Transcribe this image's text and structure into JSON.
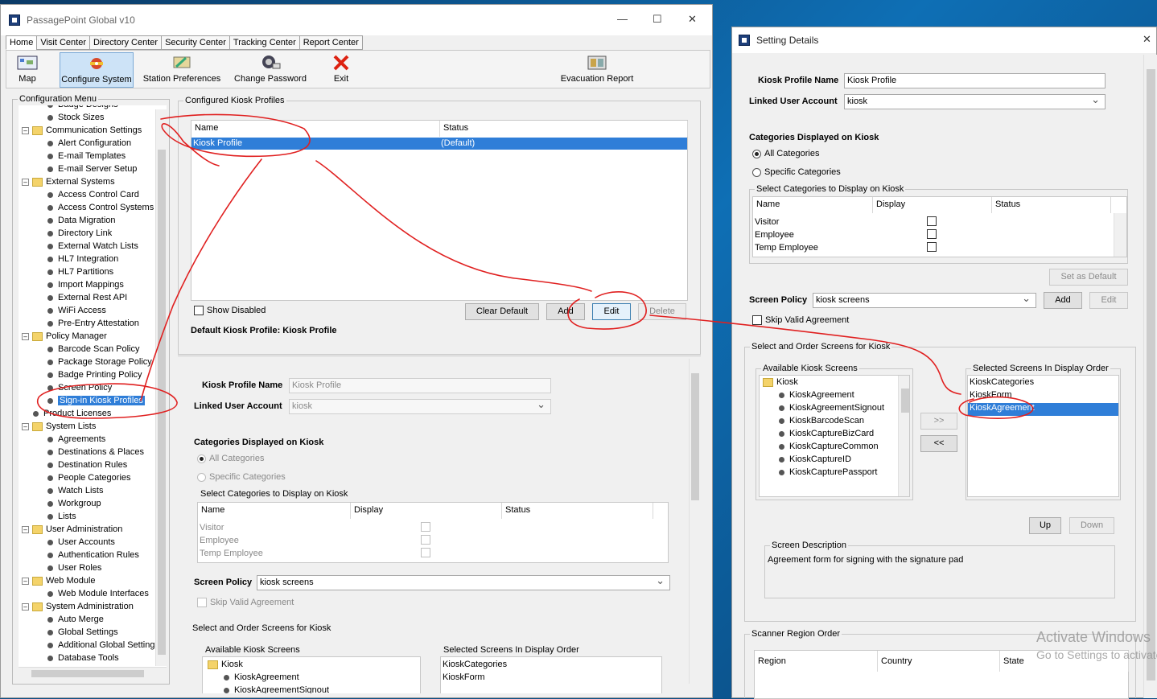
{
  "main_window": {
    "title": "PassagePoint Global v10",
    "tabs": [
      "Home",
      "Visit Center",
      "Directory Center",
      "Security Center",
      "Tracking Center",
      "Report Center"
    ],
    "toolbar": {
      "map": "Map",
      "configure": "Configure System",
      "station": "Station Preferences",
      "password": "Change Password",
      "exit": "Exit",
      "evac": "Evacuation Report"
    },
    "menu_title": "Configuration Menu",
    "tree": [
      {
        "t": "Badge Designs",
        "lvl": 2
      },
      {
        "t": "Stock Sizes",
        "lvl": 2
      },
      {
        "t": "Communication Settings",
        "lvl": 1
      },
      {
        "t": "Alert Configuration",
        "lvl": 2
      },
      {
        "t": "E-mail Templates",
        "lvl": 2
      },
      {
        "t": "E-mail Server Setup",
        "lvl": 2
      },
      {
        "t": "External Systems",
        "lvl": 1
      },
      {
        "t": "Access Control Card",
        "lvl": 2
      },
      {
        "t": "Access Control Systems",
        "lvl": 2
      },
      {
        "t": "Data Migration",
        "lvl": 2
      },
      {
        "t": "Directory Link",
        "lvl": 2
      },
      {
        "t": "External Watch Lists",
        "lvl": 2
      },
      {
        "t": "HL7 Integration",
        "lvl": 2
      },
      {
        "t": "HL7 Partitions",
        "lvl": 2
      },
      {
        "t": "Import Mappings",
        "lvl": 2
      },
      {
        "t": "External Rest API",
        "lvl": 2
      },
      {
        "t": "WiFi Access",
        "lvl": 2
      },
      {
        "t": "Pre-Entry Attestation",
        "lvl": 2
      },
      {
        "t": "Policy Manager",
        "lvl": 1
      },
      {
        "t": "Barcode Scan Policy",
        "lvl": 2
      },
      {
        "t": "Package Storage Policy",
        "lvl": 2
      },
      {
        "t": "Badge Printing Policy",
        "lvl": 2
      },
      {
        "t": "Screen Policy",
        "lvl": 2
      },
      {
        "t": "Sign-in Kiosk Profiles",
        "lvl": 2,
        "sel": true
      },
      {
        "t": "Product Licenses",
        "lvl": 0
      },
      {
        "t": "System Lists",
        "lvl": 1
      },
      {
        "t": "Agreements",
        "lvl": 2
      },
      {
        "t": "Destinations & Places",
        "lvl": 2
      },
      {
        "t": "Destination Rules",
        "lvl": 2
      },
      {
        "t": "People Categories",
        "lvl": 2
      },
      {
        "t": "Watch Lists",
        "lvl": 2
      },
      {
        "t": "Workgroup",
        "lvl": 2
      },
      {
        "t": "Lists",
        "lvl": 2
      },
      {
        "t": "User Administration",
        "lvl": 1
      },
      {
        "t": "User Accounts",
        "lvl": 2
      },
      {
        "t": "Authentication Rules",
        "lvl": 2
      },
      {
        "t": "User Roles",
        "lvl": 2
      },
      {
        "t": "Web Module",
        "lvl": 1
      },
      {
        "t": "Web Module Interfaces",
        "lvl": 2
      },
      {
        "t": "System Administration",
        "lvl": 1
      },
      {
        "t": "Auto Merge",
        "lvl": 2
      },
      {
        "t": "Global Settings",
        "lvl": 2
      },
      {
        "t": "Additional Global Settings",
        "lvl": 2
      },
      {
        "t": "Database Tools",
        "lvl": 2
      }
    ],
    "profiles": {
      "legend": "Configured Kiosk Profiles",
      "col_name": "Name",
      "col_status": "Status",
      "row_name": "Kiosk Profile",
      "row_status": "(Default)",
      "show_disabled": "Show Disabled",
      "clear_default": "Clear Default",
      "add": "Add",
      "edit": "Edit",
      "delete": "Delete",
      "default_label": "Default Kiosk Profile: Kiosk Profile"
    },
    "detail": {
      "profile_name_label": "Kiosk Profile Name",
      "profile_name_value": "Kiosk Profile",
      "linked_label": "Linked User Account",
      "linked_value": "kiosk",
      "cats_label": "Categories Displayed on Kiosk",
      "all_cats": "All Categories",
      "specific_cats": "Specific Categories",
      "select_cats": "Select Categories to Display on Kiosk",
      "col_name": "Name",
      "col_display": "Display",
      "col_status": "Status",
      "rows": [
        "Visitor",
        "Employee",
        "Temp Employee"
      ],
      "screen_policy_label": "Screen Policy",
      "screen_policy_value": "kiosk screens",
      "skip": "Skip Valid Agreement",
      "order_legend": "Select and Order Screens for Kiosk",
      "available": "Available Kiosk Screens",
      "selected": "Selected Screens In Display Order",
      "kiosk_folder": "Kiosk",
      "avail_items": [
        "KioskAgreement",
        "KioskAgreementSignout"
      ],
      "sel_items": [
        "KioskCategories",
        "KioskForm"
      ]
    }
  },
  "dialog": {
    "title": "Setting Details",
    "profile_name_label": "Kiosk Profile Name",
    "profile_name_value": "Kiosk Profile",
    "linked_label": "Linked User Account",
    "linked_value": "kiosk",
    "cats_label": "Categories Displayed on Kiosk",
    "all_cats": "All Categories",
    "specific_cats": "Specific Categories",
    "select_cats": "Select Categories to Display on Kiosk",
    "col_name": "Name",
    "col_display": "Display",
    "col_status": "Status",
    "rows": [
      "Visitor",
      "Employee",
      "Temp Employee"
    ],
    "set_default": "Set as Default",
    "screen_policy_label": "Screen Policy",
    "screen_policy_value": "kiosk screens",
    "add": "Add",
    "edit": "Edit",
    "skip": "Skip Valid Agreement",
    "order_legend": "Select and Order Screens for Kiosk",
    "available": "Available Kiosk Screens",
    "selected": "Selected Screens In Display Order",
    "kiosk_folder": "Kiosk",
    "avail_items": [
      "KioskAgreement",
      "KioskAgreementSignout",
      "KioskBarcodeScan",
      "KioskCaptureBizCard",
      "KioskCaptureCommon",
      "KioskCaptureID",
      "KioskCapturePassport"
    ],
    "sel_items": [
      "KioskCategories",
      "KioskForm",
      "KioskAgreement"
    ],
    "move_right": ">>",
    "move_left": "<<",
    "up": "Up",
    "down": "Down",
    "desc_legend": "Screen Description",
    "desc_text": "Agreement form for signing with the signature pad",
    "scanner_legend": "Scanner Region Order",
    "col_region": "Region",
    "col_country": "Country",
    "col_state": "State"
  },
  "watermark": {
    "line1": "Activate Windows",
    "line2": "Go to Settings to activate Windows."
  },
  "colors": {
    "selection": "#2f7ed8",
    "annotation": "#e02020"
  }
}
